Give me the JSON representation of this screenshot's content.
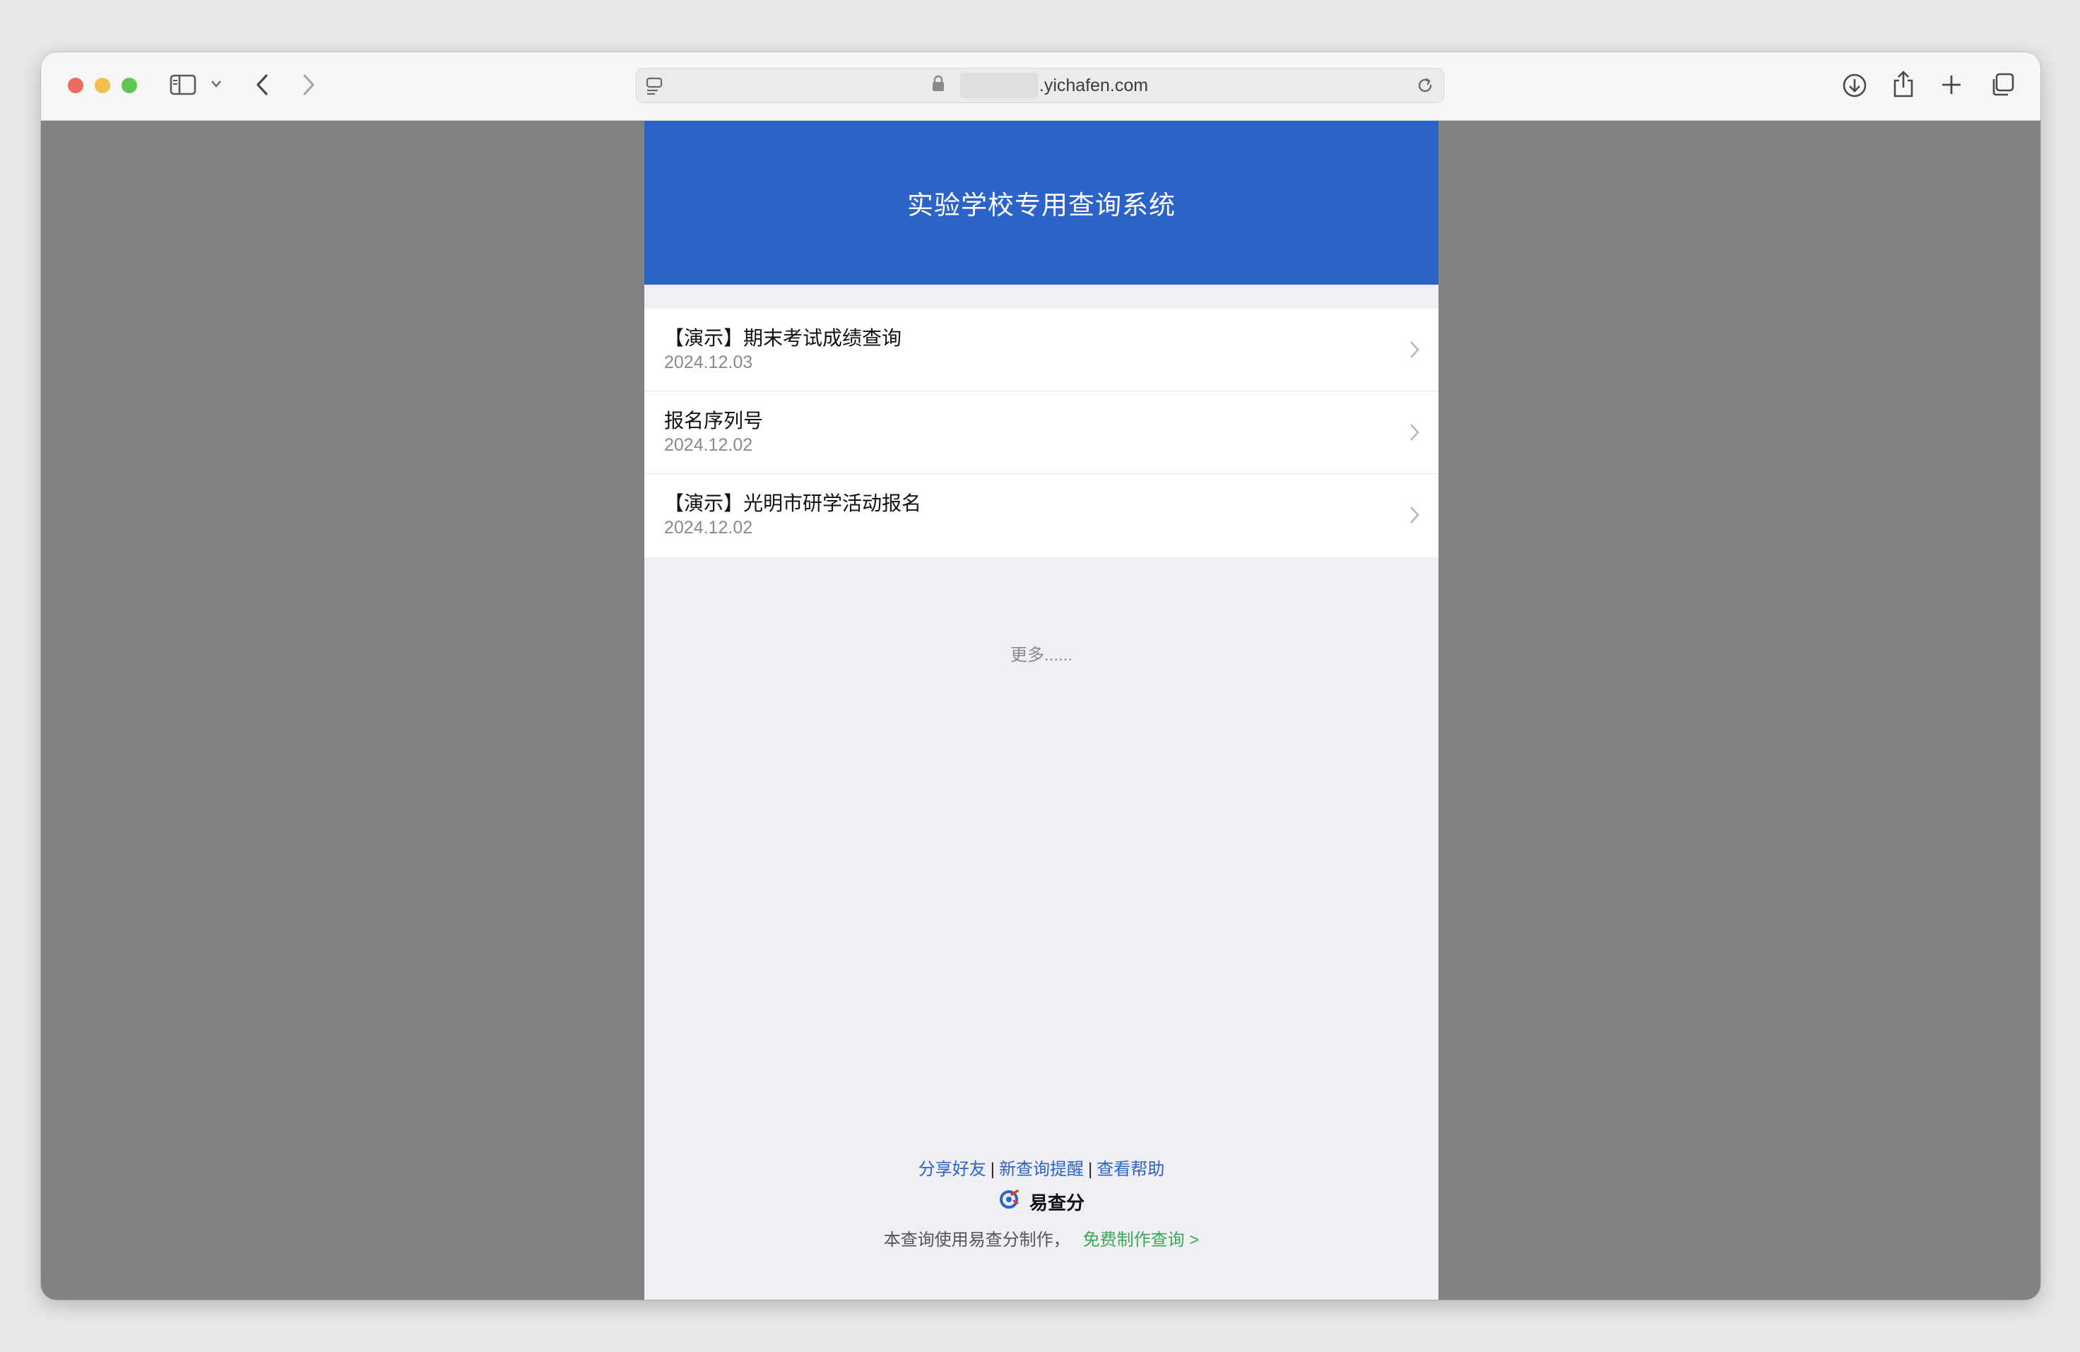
{
  "browser": {
    "url_domain": ".yichafen.com",
    "icons": [
      "sidebar-icon",
      "chevron-down-icon",
      "back-icon",
      "forward-icon",
      "page-menu-icon",
      "lock-icon",
      "reload-icon",
      "download-icon",
      "share-icon",
      "new-tab-icon",
      "tabs-overview-icon"
    ]
  },
  "page": {
    "title": "实验学校专用查询系统",
    "items": [
      {
        "title": "【演示】期末考试成绩查询",
        "date": "2024.12.03"
      },
      {
        "title": "报名序列号",
        "date": "2024.12.02"
      },
      {
        "title": "【演示】光明市研学活动报名",
        "date": "2024.12.02"
      }
    ],
    "more_label": "更多......",
    "footer": {
      "share_label": "分享好友",
      "separator": "|",
      "remind_label": "新查询提醒",
      "help_label": "查看帮助",
      "brand_name": "易查分",
      "made_text": "本查询使用易查分制作，",
      "free_link": "免费制作查询 >"
    }
  },
  "colors": {
    "header_blue": "#2b63c8",
    "link_blue": "#2b63c8",
    "link_green": "#3aa757",
    "page_bg": "#efeff4",
    "outer_bg": "#828282"
  }
}
